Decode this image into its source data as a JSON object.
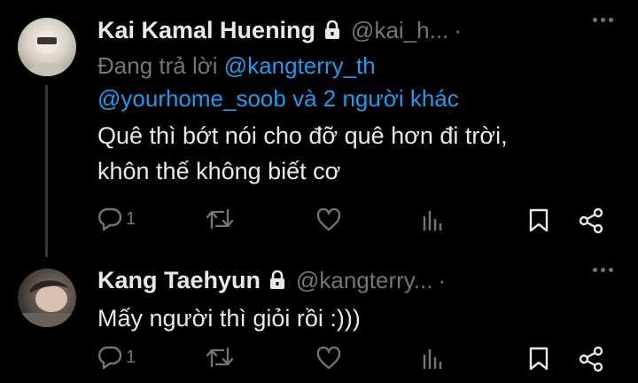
{
  "tweets": [
    {
      "display_name": "Kai Kamal Huening",
      "handle": "@kai_h...",
      "separator": "·",
      "replying_prefix": "Đang trả lời",
      "replying_mention": "@kangterry_th",
      "replying_second_line_mention": "@yourhome_soob",
      "replying_suffix": "và 2 người khác",
      "text_line1": "Quê thì bớt nói cho đỡ quê hơn đi trời,",
      "text_line2": "khôn thế không biết cơ",
      "reply_count": "1"
    },
    {
      "display_name": "Kang Taehyun",
      "handle": "@kangterry...",
      "separator": "·",
      "text_line1": "Mấy người thì giỏi rồi :)))",
      "reply_count": "1"
    }
  ],
  "icons": {
    "reply": "reply-icon",
    "retweet": "retweet-icon",
    "like": "heart-icon",
    "views": "views-icon",
    "bookmark": "bookmark-icon",
    "share": "share-icon",
    "lock": "lock-icon",
    "more": "more-icon"
  },
  "colors": {
    "background": "#000000",
    "text": "#e7e9ea",
    "secondary": "#71767b",
    "accent": "#1d9bf0",
    "thread_line": "#333639"
  }
}
